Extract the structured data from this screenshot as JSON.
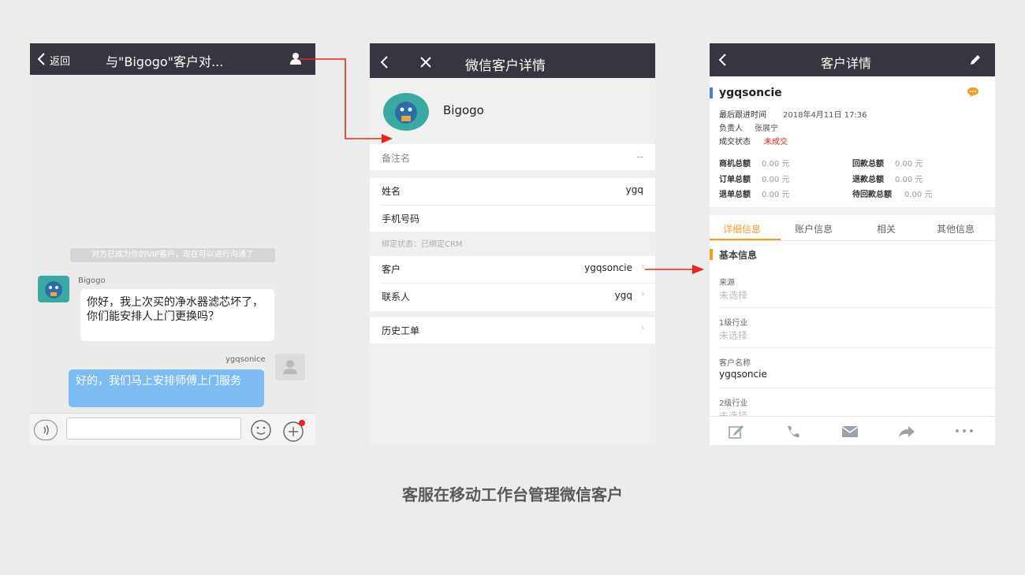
{
  "chat": {
    "back_label": "返回",
    "title": "与\"Bigogo\"客户对...",
    "system_notice": "对方已成为你的VIP客户，现在可以进行沟通了",
    "incoming_sender": "Bigogo",
    "incoming_message": "你好，我上次买的净水器滤芯坏了，你们能安排人上门更换吗？",
    "outgoing_sender": "ygqsonice",
    "outgoing_message": "好的，我们马上安排师傅上门服务",
    "input_value": ""
  },
  "wechat_detail": {
    "title": "微信客户详情",
    "profile_name": "Bigogo",
    "remark_label": "备注名",
    "remark_value": "--",
    "name_label": "姓名",
    "name_value": "ygq",
    "phone_label": "手机号码",
    "phone_value": "",
    "bind_status": "绑定状态：已绑定CRM",
    "customer_label": "客户",
    "customer_value": "ygqsoncie",
    "contact_label": "联系人",
    "contact_value": "ygq",
    "history_label": "历史工单"
  },
  "customer_detail": {
    "title": "客户详情",
    "customer_name": "ygqsoncie",
    "last_follow_label": "最后跟进时间",
    "last_follow_value": "2018年4月11日 17:36",
    "owner_label": "负责人",
    "owner_value": "张展宁",
    "deal_label": "成交状态",
    "deal_value": "未成交",
    "stats": [
      {
        "label": "商机总额",
        "value": "0.00 元"
      },
      {
        "label": "回款总额",
        "value": "0.00 元"
      },
      {
        "label": "订单总额",
        "value": "0.00 元"
      },
      {
        "label": "退款总额",
        "value": "0.00 元"
      },
      {
        "label": "退单总额",
        "value": "0.00 元"
      },
      {
        "label": "待回款总额",
        "value": "0.00 元"
      }
    ],
    "tabs": [
      "详细信息",
      "账户信息",
      "相关",
      "其他信息"
    ],
    "section_title": "基本信息",
    "fields": [
      {
        "label": "来源",
        "value": "未选择"
      },
      {
        "label": "1级行业",
        "value": "未选择"
      },
      {
        "label": "客户名称",
        "value": "ygqsoncie"
      },
      {
        "label": "2级行业",
        "value": "未选择"
      }
    ]
  },
  "caption": "客服在移动工作台管理微信客户",
  "colors": {
    "header": "#363640",
    "accent_orange": "#f39c2b",
    "arrow_red": "#e8251c",
    "bubble_blue": "#7cbcf2",
    "section_blue": "#4a7fd8",
    "deal_red": "#e8251c"
  }
}
